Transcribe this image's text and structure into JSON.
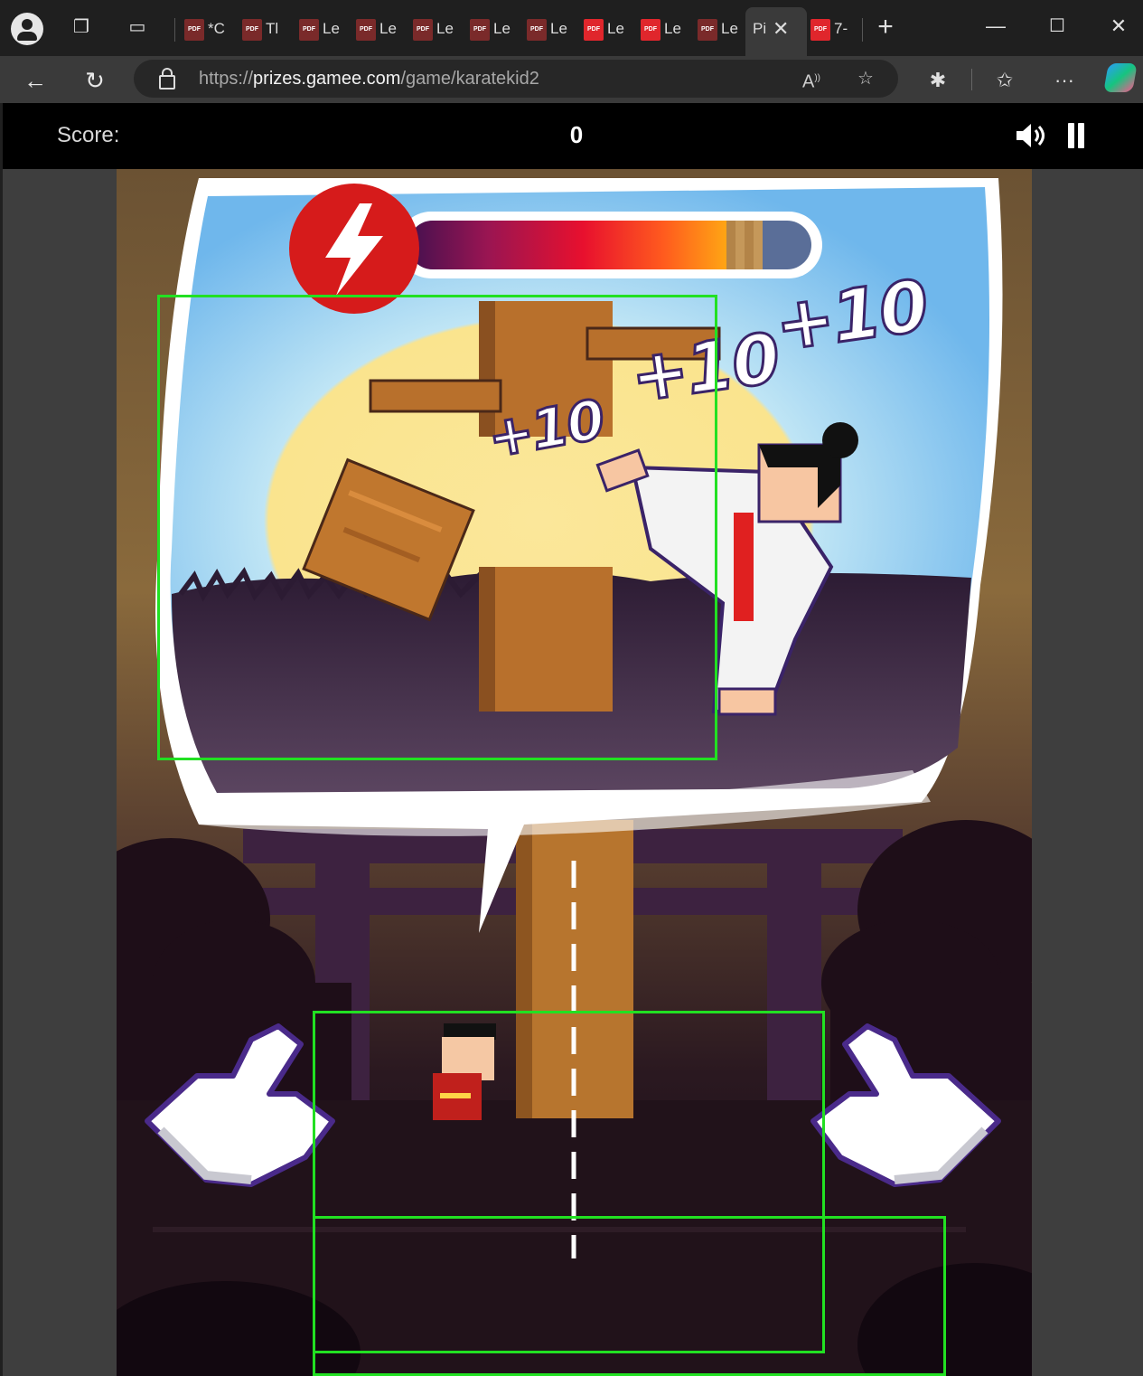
{
  "browser": {
    "tabs": [
      {
        "label": "*C",
        "icon": "pdf-icon"
      },
      {
        "label": "Tl",
        "icon": "pdf-icon"
      },
      {
        "label": "Le",
        "icon": "pdf-icon"
      },
      {
        "label": "Le",
        "icon": "pdf-icon"
      },
      {
        "label": "Le",
        "icon": "pdf-icon"
      },
      {
        "label": "Le",
        "icon": "pdf-icon"
      },
      {
        "label": "Le",
        "icon": "pdf-icon"
      },
      {
        "label": "Le",
        "icon": "pdf-icon"
      },
      {
        "label": "Le",
        "icon": "pdf-icon"
      },
      {
        "label": "Le",
        "icon": "pdf-icon"
      },
      {
        "label": "Pi",
        "icon": "none",
        "active": true
      },
      {
        "label": "7-",
        "icon": "pdf-icon"
      }
    ],
    "url_scheme": "https://",
    "url_host": "prizes.gamee.com",
    "url_path": "/game/karatekid2"
  },
  "game": {
    "score_label": "Score:",
    "score_value": "0",
    "energy_level": 0.88,
    "bonus_texts": [
      "+10",
      "+10",
      "+10"
    ],
    "colors": {
      "energy_badge": "#d61b1b",
      "detection_box": "#22e022",
      "gi_belt": "#e02020"
    }
  }
}
